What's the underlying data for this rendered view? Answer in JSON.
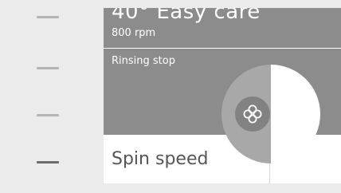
{
  "program": {
    "title": "40° Easy care",
    "speed": "800 rpm"
  },
  "option": {
    "label": "Rinsing stop"
  },
  "spin": {
    "label": "Spin speed"
  },
  "icons": {
    "knob": "flower-icon"
  },
  "colors": {
    "panel": "#8c8c8c",
    "accent_dark": "#6c6c6c",
    "dial_left": "#a8a8a8",
    "dial_right": "#ffffff"
  }
}
